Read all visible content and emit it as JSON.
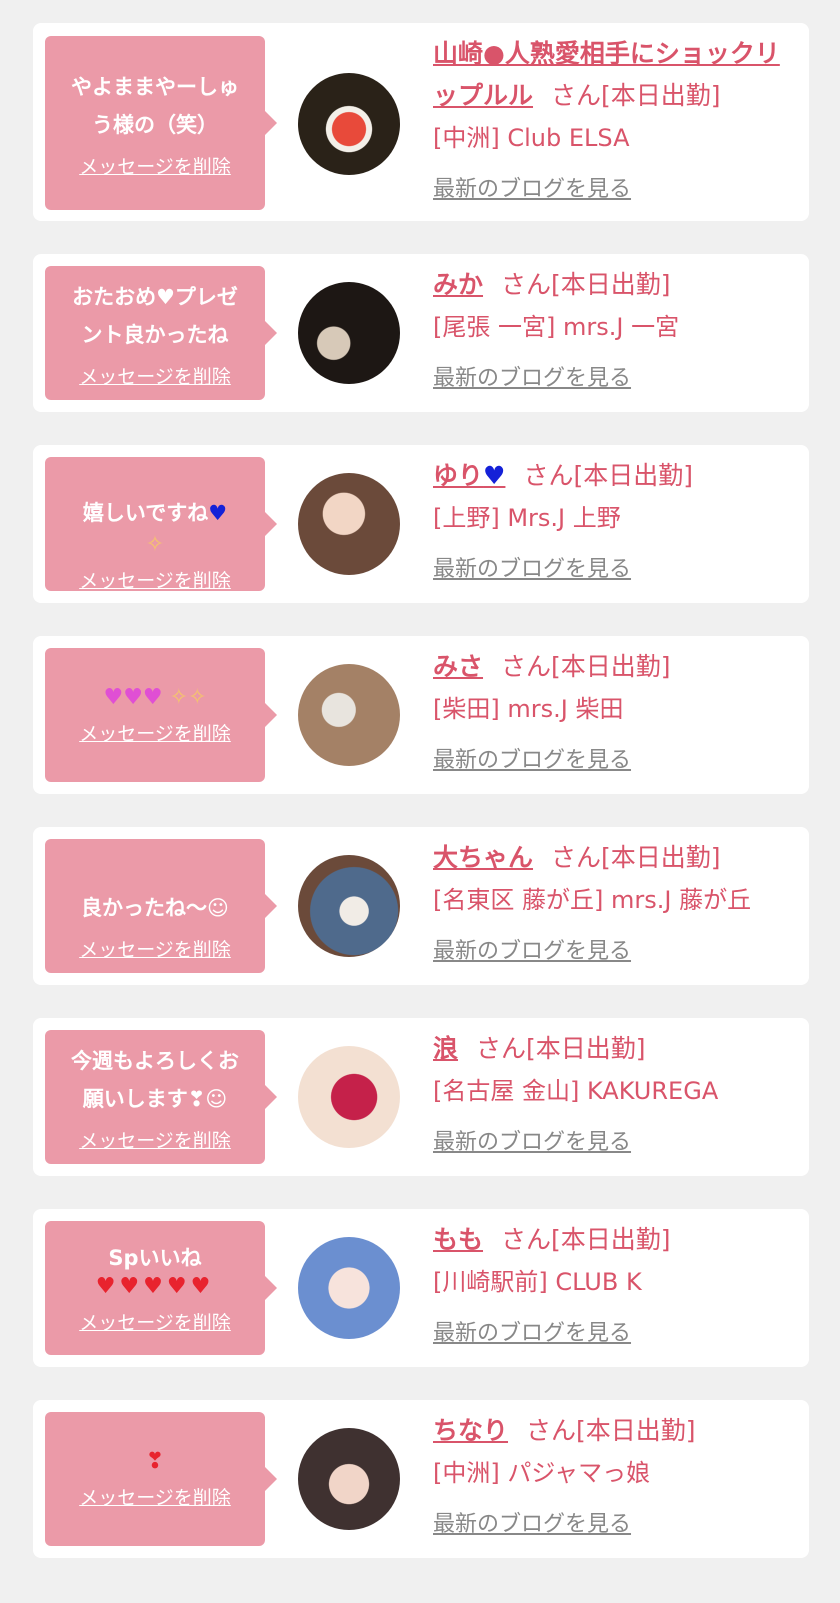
{
  "colors": {
    "background": "#f0f0f0",
    "card": "#ffffff",
    "bubble": "#eb9aa8",
    "accent": "#d9546a",
    "link_gray": "#888888"
  },
  "delete_label": "メッセージを削除",
  "blog_label": "最新のブログを見る",
  "items": [
    {
      "message": "やよままやーしゅ\nう様の（笑）",
      "name": "山崎●人熟愛相手にショックリップルル",
      "suffix": "さん[本日出勤]",
      "shop": "[中洲] Club ELSA"
    },
    {
      "message": "おたおめ♥プレゼ\nント良かったね",
      "name": "みか",
      "suffix": "さん[本日出勤]",
      "shop": "[尾張 一宮] mrs.J 一宮"
    },
    {
      "message": "嬉しいですね",
      "message_emoji": "♥",
      "message_line2": "✧",
      "name": "ゆり",
      "name_emoji": "♥",
      "suffix": "さん[本日出勤]",
      "shop": "[上野] Mrs.J 上野"
    },
    {
      "message_hearts": "♥♥♥",
      "message_sparkles": "✧✧",
      "name": "みさ",
      "suffix": "さん[本日出勤]",
      "shop": "[柴田] mrs.J 柴田"
    },
    {
      "message": "良かったね〜",
      "message_emoji": "☺",
      "name": "大ちゃん",
      "suffix": "さん[本日出勤]",
      "shop": "[名東区 藤が丘] mrs.J 藤が丘"
    },
    {
      "message": "今週もよろしくお\n願いします❣☺",
      "name": "浪",
      "suffix": "さん[本日出勤]",
      "shop": "[名古屋 金山] KAKUREGA"
    },
    {
      "message": "Spいいね",
      "message_hearts": "♥♥♥♥♥",
      "name": "もも",
      "suffix": "さん[本日出勤]",
      "shop": "[川崎駅前] CLUB K"
    },
    {
      "message_emoji": "❣",
      "name": "ちなり",
      "suffix": "さん[本日出勤]",
      "shop": "[中洲] パジャマっ娘"
    }
  ]
}
